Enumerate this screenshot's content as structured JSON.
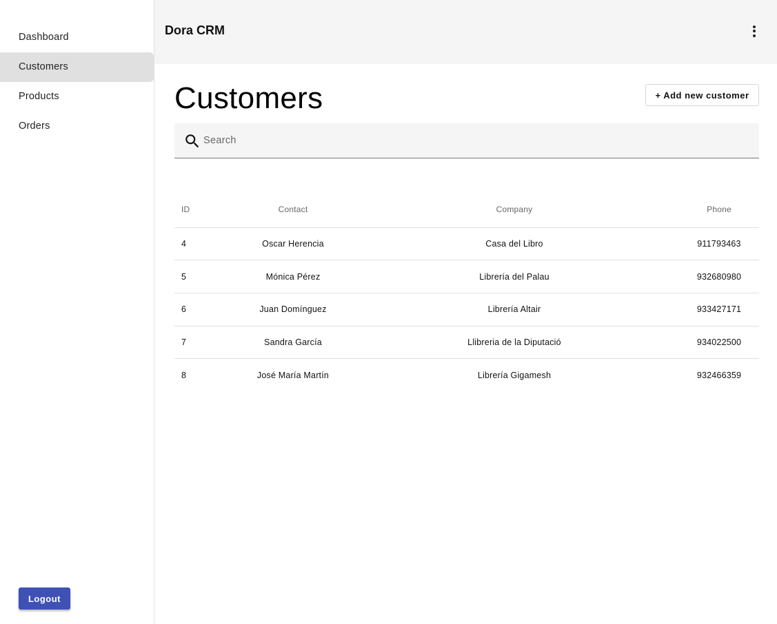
{
  "app": {
    "title": "Dora CRM"
  },
  "sidebar": {
    "items": [
      {
        "label": "Dashboard",
        "active": false
      },
      {
        "label": "Customers",
        "active": true
      },
      {
        "label": "Products",
        "active": false
      },
      {
        "label": "Orders",
        "active": false
      }
    ],
    "logout_label": "Logout"
  },
  "topbar": {
    "menu_icon": "more-vert-icon"
  },
  "page": {
    "title": "Customers",
    "add_button_label": "+ Add new customer",
    "search": {
      "placeholder": "Search",
      "value": "",
      "icon": "search-icon"
    }
  },
  "table": {
    "columns": [
      "ID",
      "Contact",
      "Company",
      "Phone"
    ],
    "rows": [
      {
        "id": "4",
        "contact": "Oscar Herencia",
        "company": "Casa del Libro",
        "phone": "911793463"
      },
      {
        "id": "5",
        "contact": "Mónica Pérez",
        "company": "Librería del Palau",
        "phone": "932680980"
      },
      {
        "id": "6",
        "contact": "Juan Domínguez",
        "company": "Librería Altair",
        "phone": "933427171"
      },
      {
        "id": "7",
        "contact": "Sandra García",
        "company": "Llibreria de la Diputació",
        "phone": "934022500"
      },
      {
        "id": "8",
        "contact": "José María Martín",
        "company": "Librería Gigamesh",
        "phone": "932466359"
      }
    ]
  },
  "colors": {
    "accent": "#3f51b5",
    "topbar_bg": "#f5f5f5",
    "active_nav_bg": "#e0e0e0"
  }
}
